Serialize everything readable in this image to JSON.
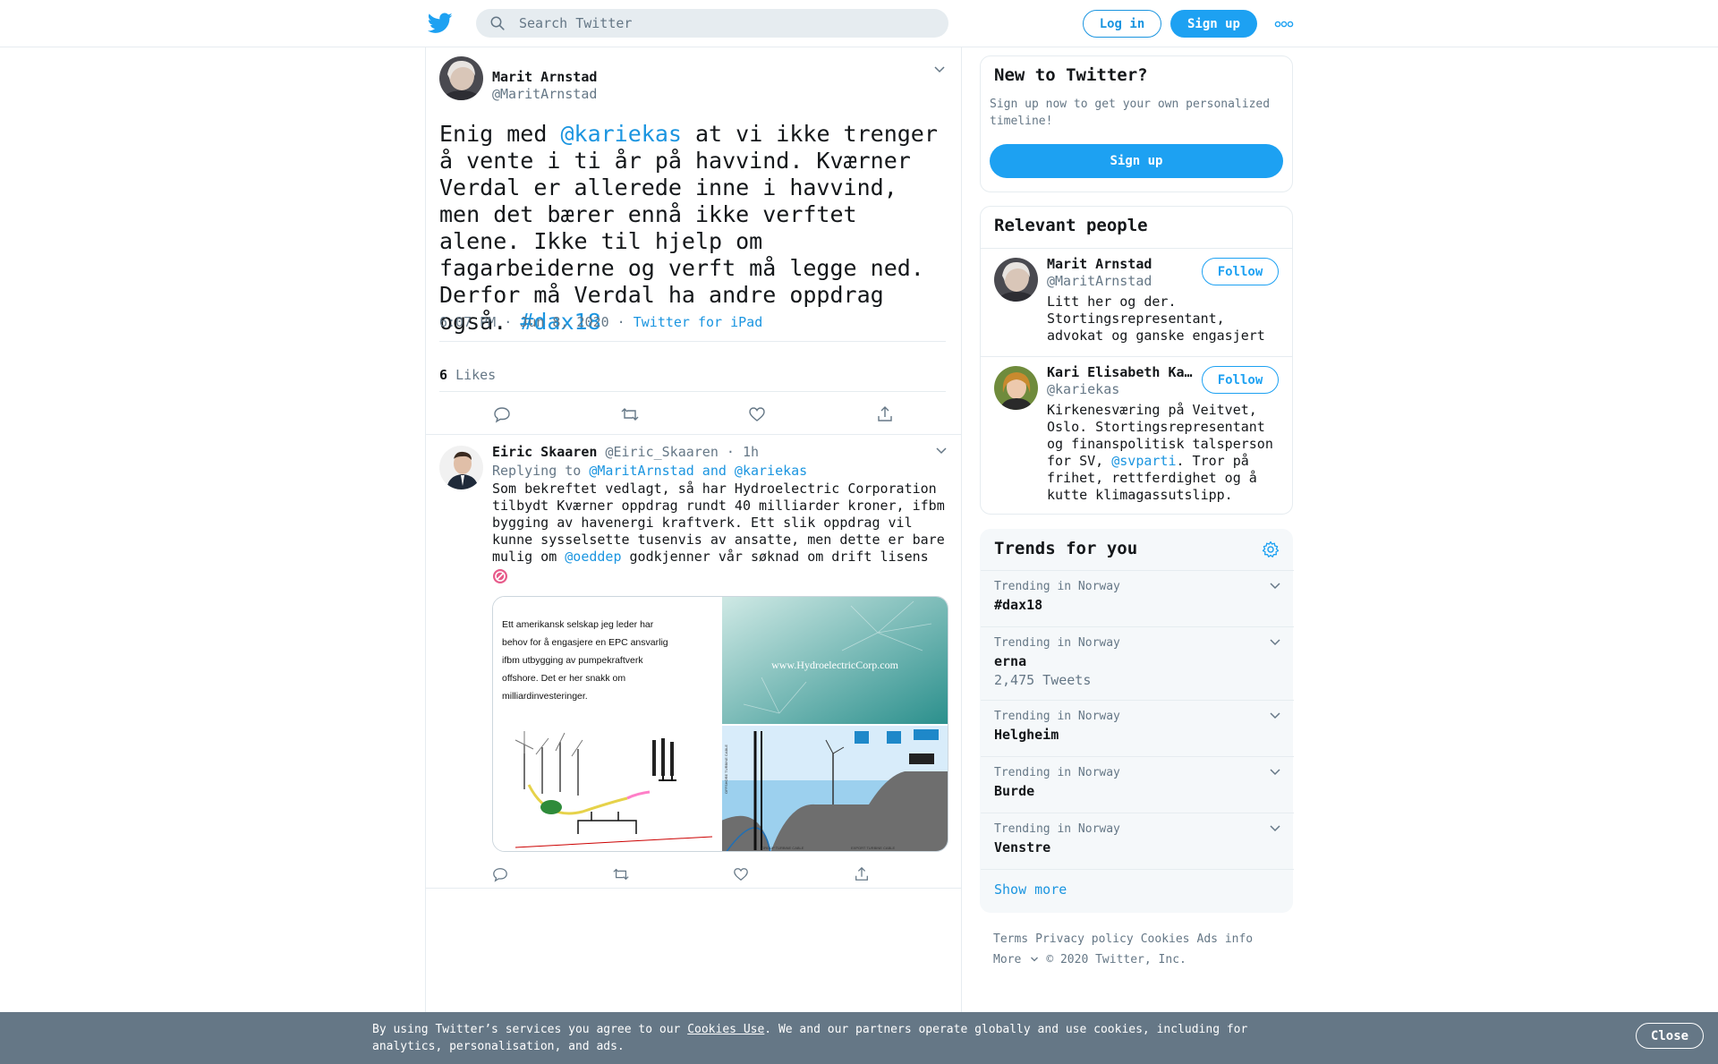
{
  "header": {
    "search_placeholder": "Search Twitter",
    "login_label": "Log in",
    "signup_label": "Sign up"
  },
  "tweet": {
    "author_name": "Marit Arnstad",
    "author_handle": "@MaritArnstad",
    "text_parts": [
      "Enig med ",
      "@kariekas",
      " at vi ikke trenger å vente i ti år på havvind. Kværner Verdal er allerede inne i havvind, men det bærer ennå ikke verftet alene. Ikke til hjelp om fagarbeiderne og verft må legge ned. Derfor må Verdal ha andre oppdrag også. ",
      "#dax18"
    ],
    "time": "6:07 PM · Jun 8, 2020",
    "meta_sep": " · ",
    "source": "Twitter for iPad",
    "likes_count": "6",
    "likes_label": "Likes"
  },
  "reply": {
    "author_name": "Eiric Skaaren",
    "author_handle": "@Eiric_Skaaren",
    "time": " · 1h",
    "replying_prefix": "Replying to ",
    "replying_to": "@MaritArnstad and @kariekas",
    "text_before": "Som bekreftet vedlagt, så har Hydroelectric Corporation tilbydt Kværner oppdrag rundt 40 milliarder kroner, ifbm bygging av havenergi kraftverk. Ett slik oppdrag vil kunne sysselsette tusenvis av ansatte, men dette er bare mulig om ",
    "mention": "@oeddep",
    "text_after": " godkjenner vår søknad om drift lisens",
    "media": {
      "left_text": "Ett amerikansk selskap jeg leder har behov for å engasjere en EPC ansvarlig ifbm utbygging av pumpekraftverk offshore. Det er her snakk om milliardinvesteringer.",
      "right_url": "www.HydroelectricCorp.com",
      "diagram_label_left": "OFFSHORE TURBINE CABLE",
      "diagram_label_bottom_left": "GROUP TURBINE CABLE",
      "diagram_label_bottom_right": "EXPORT TURBINE CABLE"
    }
  },
  "sidebar": {
    "new_to": {
      "title": "New to Twitter?",
      "desc": "Sign up now to get your own personalized timeline!",
      "button": "Sign up"
    },
    "relevant": {
      "title": "Relevant people",
      "people": [
        {
          "name": "Marit Arnstad",
          "handle": "@MaritArnstad",
          "follow": "Follow",
          "bio": "Litt her og der. Stortingsrepresentant, advokat og ganske engasjert"
        },
        {
          "name": "Kari Elisabeth Kaski",
          "handle": "@kariekas",
          "follow": "Follow",
          "bio_before": "Kirkenesværing på Veitvet, Oslo. Stortingsrepresentant og finanspolitisk talsperson for SV, ",
          "bio_mention": "@svparti",
          "bio_after": ". Tror på frihet, rettferdighet og å kutte klimagassutslipp."
        }
      ]
    },
    "trends": {
      "title": "Trends for you",
      "items": [
        {
          "category": "Trending in Norway",
          "name": "#dax18",
          "count": ""
        },
        {
          "category": "Trending in Norway",
          "name": "erna",
          "count": "2,475 Tweets"
        },
        {
          "category": "Trending in Norway",
          "name": "Helgheim",
          "count": ""
        },
        {
          "category": "Trending in Norway",
          "name": "Burde",
          "count": ""
        },
        {
          "category": "Trending in Norway",
          "name": "Venstre",
          "count": ""
        }
      ],
      "show_more": "Show more"
    },
    "footer": {
      "links": [
        "Terms",
        "Privacy policy",
        "Cookies",
        "Ads info"
      ],
      "more": "More",
      "copyright": "© 2020 Twitter, Inc."
    }
  },
  "cookie_bar": {
    "text_before": "By using Twitter’s services you agree to our ",
    "link": "Cookies Use",
    "text_after": ". We and our partners operate globally and use cookies, including for analytics, personalisation, and ads.",
    "close": "Close"
  },
  "colors": {
    "accent": "#1da1f2",
    "link": "#1b95e0",
    "muted": "#657786",
    "cookie_bg": "#657786"
  }
}
